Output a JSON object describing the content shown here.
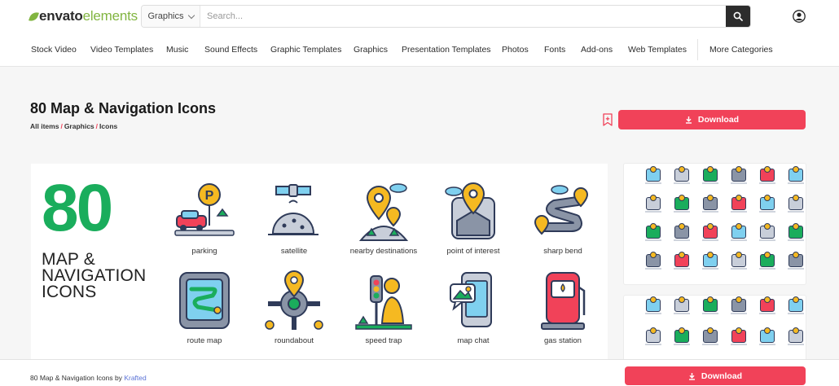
{
  "brand": {
    "logo_part1": "envato",
    "logo_part2": "elements",
    "accent": "#82b541"
  },
  "search": {
    "category": "Graphics",
    "placeholder": "Search..."
  },
  "nav": [
    "Stock Video",
    "Video Templates",
    "Music",
    "Sound Effects",
    "Graphic Templates",
    "Graphics",
    "Presentation Templates",
    "Photos",
    "Fonts",
    "Add-ons",
    "Web Templates",
    "More Categories"
  ],
  "item": {
    "title": "80 Map & Navigation Icons",
    "breadcrumb": [
      "All items",
      "Graphics",
      "Icons"
    ],
    "download_label": "Download",
    "author_prefix": "80 Map & Navigation Icons by",
    "author": "Krafted"
  },
  "preview": {
    "big_number": "80",
    "big_text": [
      "MAP &",
      "NAVIGATION",
      "ICONS"
    ],
    "icons": [
      "parking",
      "satellite",
      "nearby destinations",
      "point of interest",
      "sharp bend",
      "route map",
      "roundabout",
      "speed trap",
      "map chat",
      "gas station"
    ]
  },
  "colors": {
    "download": "#f14259",
    "green": "#1aad5c",
    "navy": "#2f3b59",
    "yellow": "#f5b921",
    "sky": "#7fd0ef"
  }
}
